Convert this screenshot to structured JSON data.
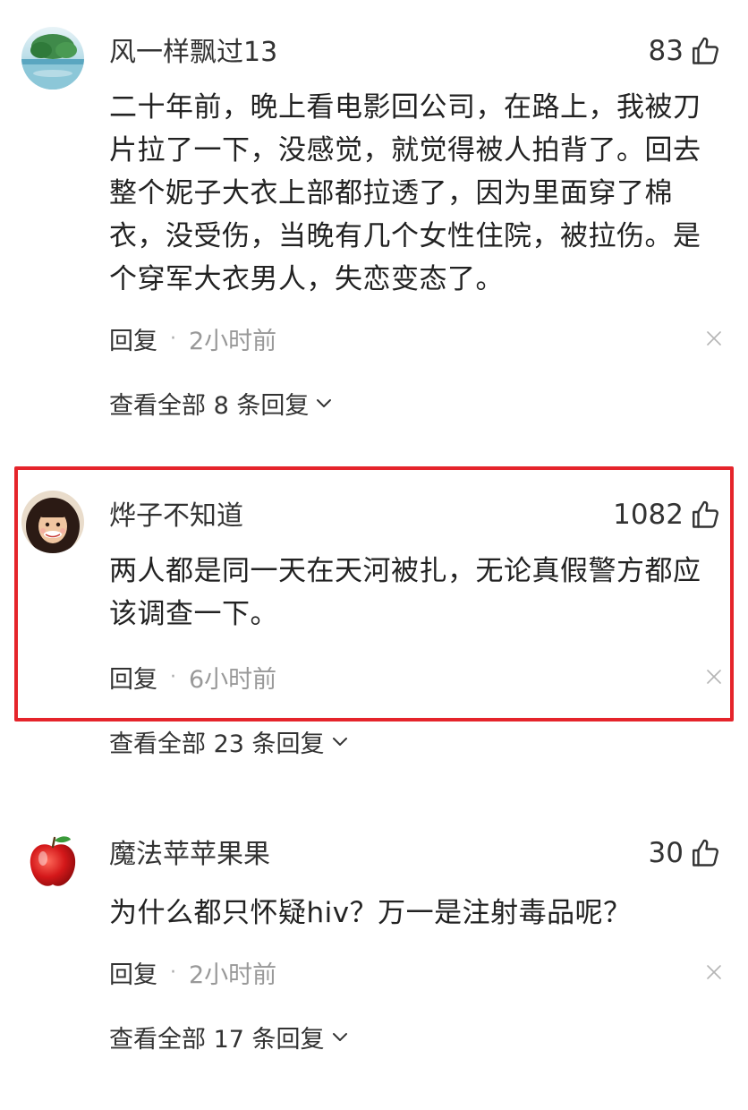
{
  "comments": [
    {
      "username": "风一样飘过13",
      "likes": "83",
      "text": "二十年前，晚上看电影回公司，在路上，我被刀片拉了一下，没感觉，就觉得被人拍背了。回去整个妮子大衣上部都拉透了，因为里面穿了棉衣，没受伤，当晚有几个女性住院，被拉伤。是个穿军大衣男人，失恋变态了。",
      "reply_label": "回复",
      "dot": "·",
      "time": "2小时前",
      "view_replies": "查看全部 8 条回复"
    },
    {
      "username": "烨子不知道",
      "likes": "1082",
      "text": "两人都是同一天在天河被扎，无论真假警方都应该调查一下。",
      "reply_label": "回复",
      "dot": "·",
      "time": "6小时前",
      "view_replies": "查看全部 23 条回复"
    },
    {
      "username": "魔法苹苹果果",
      "likes": "30",
      "text": "为什么都只怀疑hiv？万一是注射毒品呢？",
      "reply_label": "回复",
      "dot": "·",
      "time": "2小时前",
      "view_replies": "查看全部 17 条回复"
    }
  ],
  "icons": {
    "like": "thumbs-up-icon",
    "close": "close-icon",
    "expand": "chevron-down-icon"
  },
  "colors": {
    "highlight_border": "#e5242b",
    "meta_gray": "#999999",
    "text": "#222222"
  }
}
